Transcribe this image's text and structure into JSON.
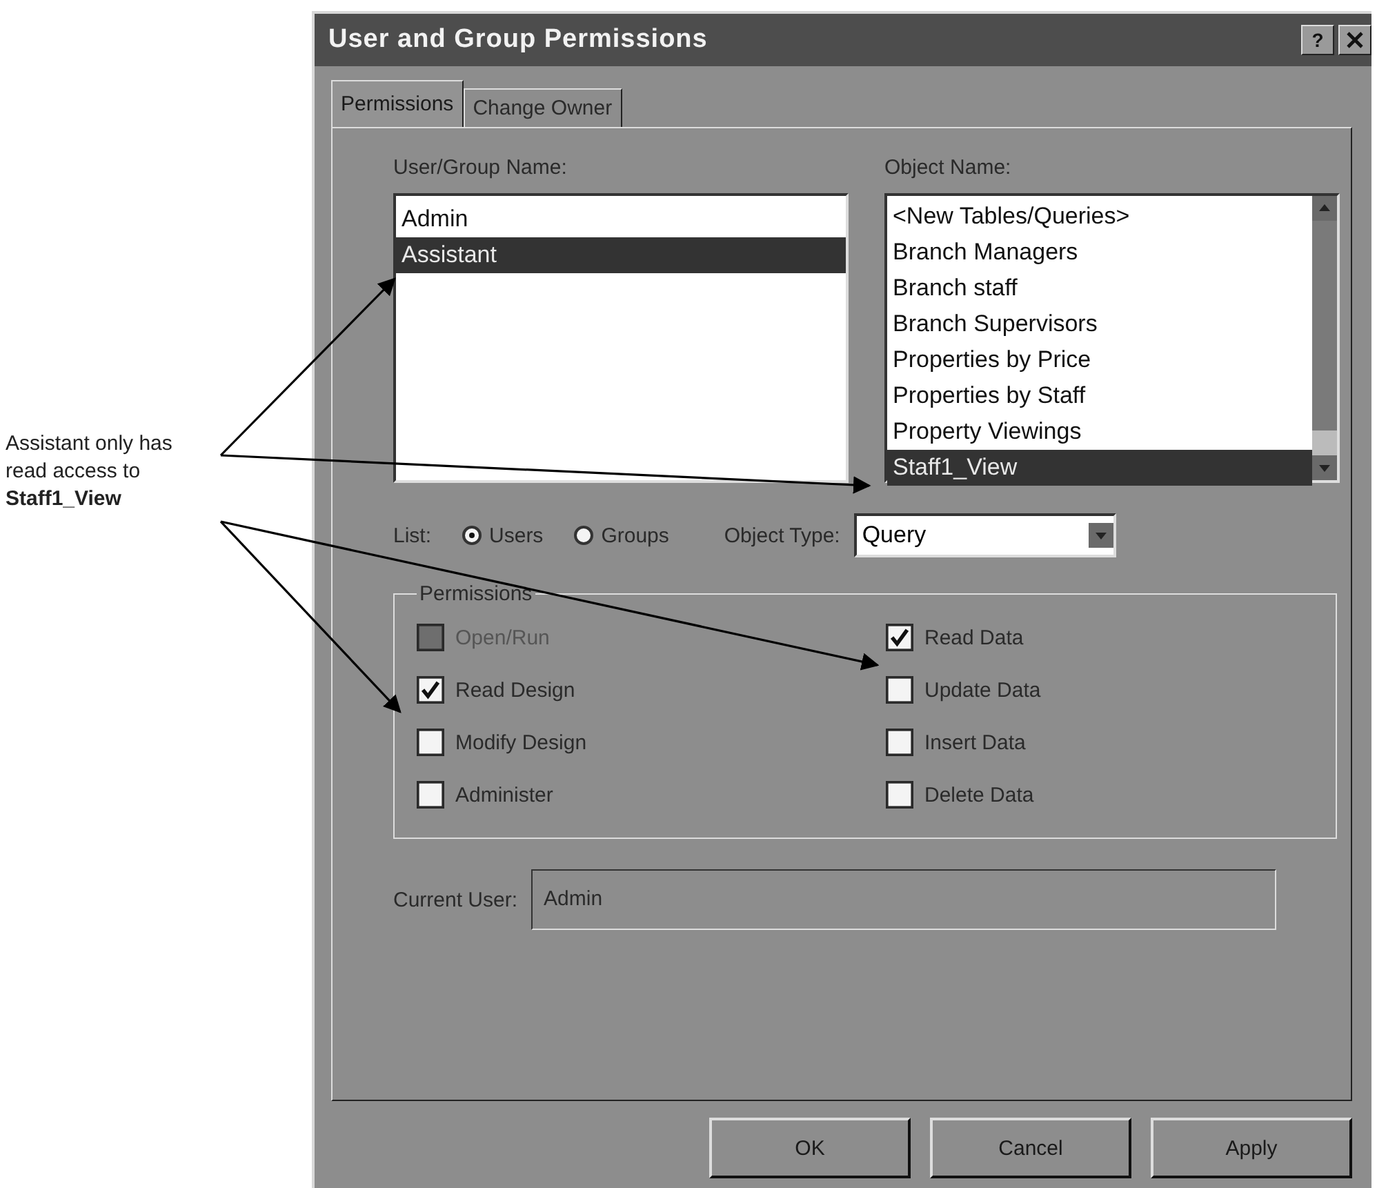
{
  "annotation": {
    "text": "Assistant only has read access to **Staff1_View**"
  },
  "window": {
    "title": "User and Group Permissions",
    "help_button": "?"
  },
  "tabs": [
    {
      "label": "Permissions",
      "selected": true
    },
    {
      "label": "Change Owner",
      "selected": false
    }
  ],
  "user_group_list": {
    "label": "User/Group Name:",
    "items": [
      {
        "label": "Admin",
        "selected": false
      },
      {
        "label": "Assistant",
        "selected": true
      }
    ]
  },
  "object_list": {
    "label": "Object Name:",
    "items": [
      {
        "label": "<New Tables/Queries>",
        "selected": false
      },
      {
        "label": "Branch Managers",
        "selected": false
      },
      {
        "label": "Branch staff",
        "selected": false
      },
      {
        "label": "Branch Supervisors",
        "selected": false
      },
      {
        "label": "Properties by Price",
        "selected": false
      },
      {
        "label": "Properties by Staff",
        "selected": false
      },
      {
        "label": "Property Viewings",
        "selected": false
      },
      {
        "label": "Staff1_View",
        "selected": true
      }
    ]
  },
  "list_filter": {
    "label": "List:",
    "options": [
      {
        "label": "Users",
        "selected": true
      },
      {
        "label": "Groups",
        "selected": false
      }
    ]
  },
  "object_type": {
    "label": "Object Type:",
    "value": "Query"
  },
  "permissions": {
    "title": "Permissions",
    "items": [
      {
        "label": "Open/Run",
        "checked": false,
        "disabled": true
      },
      {
        "label": "Read Design",
        "checked": true,
        "disabled": false
      },
      {
        "label": "Modify Design",
        "checked": false,
        "disabled": false
      },
      {
        "label": "Administer",
        "checked": false,
        "disabled": false
      },
      {
        "label": "Read Data",
        "checked": true,
        "disabled": false
      },
      {
        "label": "Update Data",
        "checked": false,
        "disabled": false
      },
      {
        "label": "Insert Data",
        "checked": false,
        "disabled": false
      },
      {
        "label": "Delete Data",
        "checked": false,
        "disabled": false
      }
    ]
  },
  "current_user": {
    "label": "Current User:",
    "value": "Admin"
  },
  "buttons": [
    {
      "label": "OK"
    },
    {
      "label": "Cancel"
    },
    {
      "label": "Apply"
    }
  ]
}
